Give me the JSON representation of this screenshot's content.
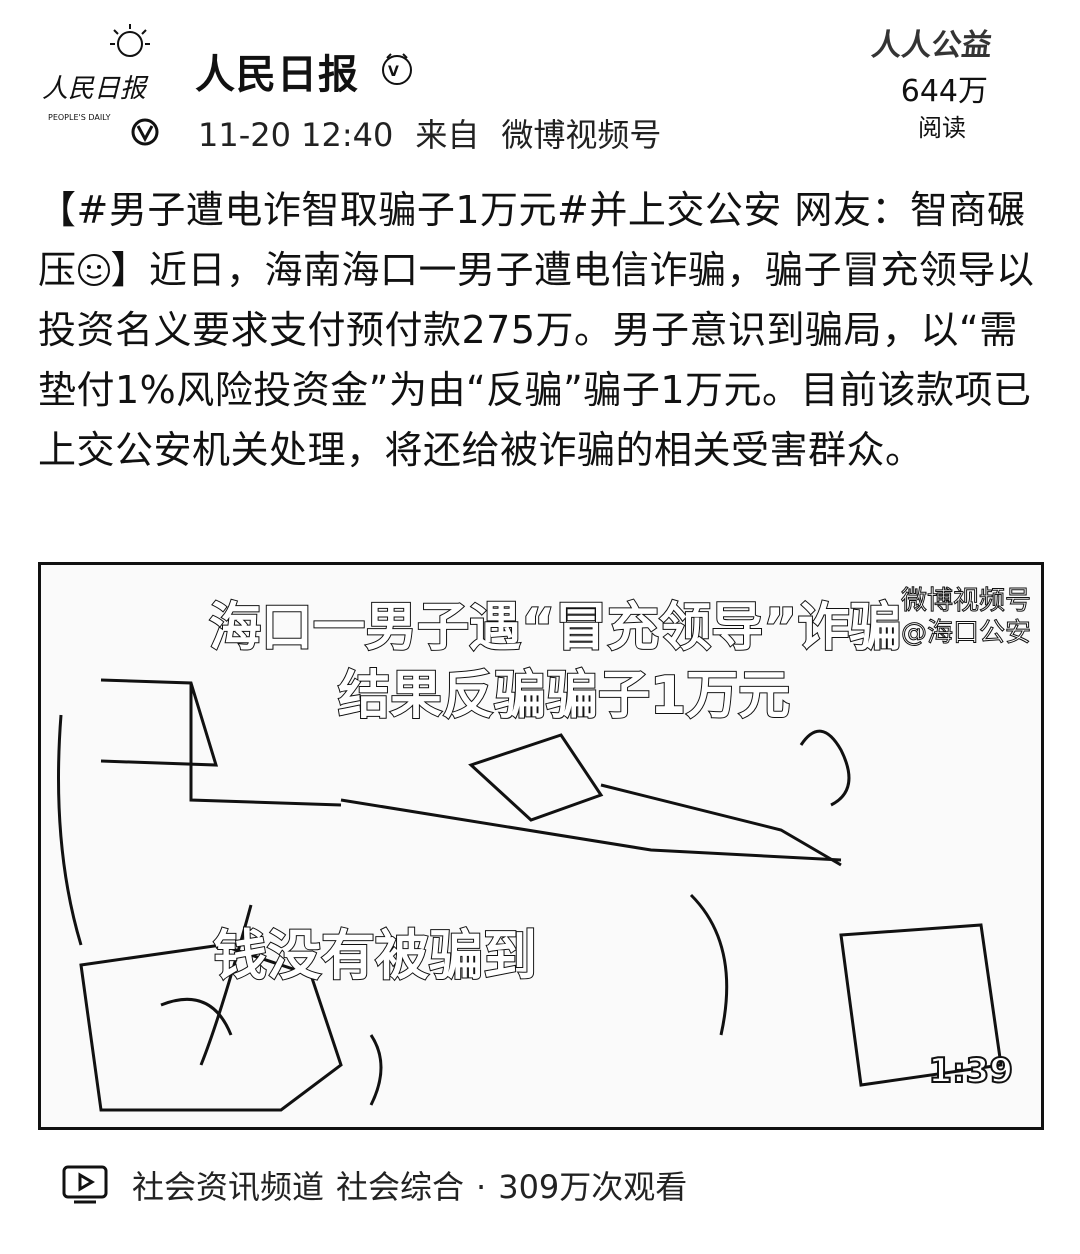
{
  "author": {
    "name": "人民日报",
    "logo_text": "人民日报",
    "logo_sub": "PEOPLE'S DAILY"
  },
  "meta": {
    "time": "11-20 12:40",
    "source_prefix": "来自",
    "source": "微博视频号"
  },
  "reads": {
    "watermark": "人人公益",
    "count": "644万",
    "label": "阅读"
  },
  "post": {
    "part1": "【#男子遭电诈智取骗子1万元#并上交公安 网友：智商碾压",
    "part2": "】近日，海南海口一男子遭电信诈骗，骗子冒充领导以投资名义要求支付预付款275万。男子意识到骗局，以“需垫付1%风险投资金”为由“反骗”骗子1万元。目前该款项已上交公安机关处理，将还给被诈骗的相关受害群众。",
    "emoji": "doge-emoji"
  },
  "video": {
    "caption_line1": "海口一男子遇“冒充领导”诈骗",
    "caption_line2": "结果反骗骗子1万元",
    "subtitle": "钱没有被骗到",
    "watermark_line1": "微博视频号",
    "watermark_line2": "@海口公安",
    "duration": "1:39"
  },
  "footer": {
    "channel": "社会资讯频道",
    "category": "社会综合",
    "separator": "·",
    "views": "309万次观看"
  }
}
